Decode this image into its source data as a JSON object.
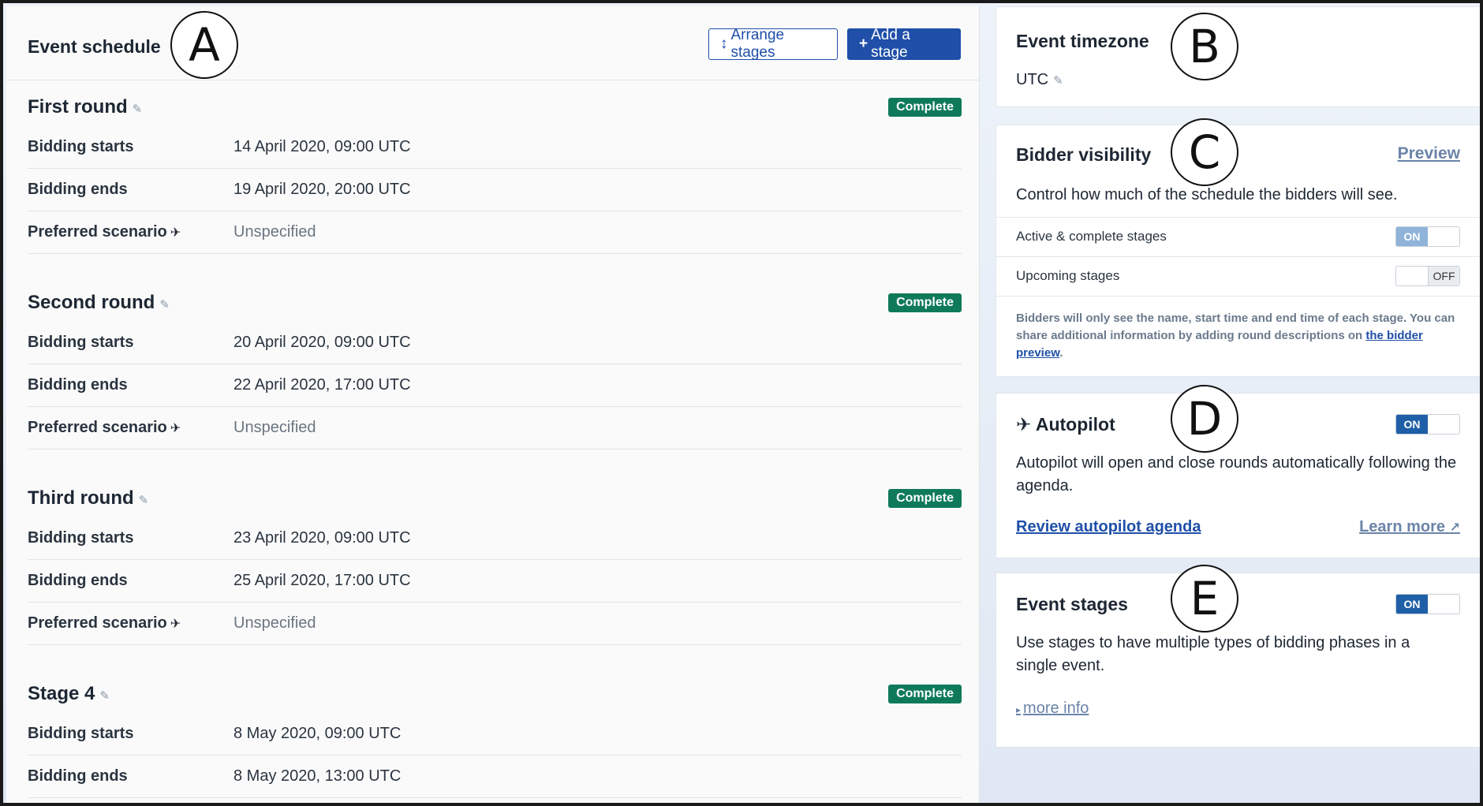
{
  "schedule": {
    "title": "Event schedule",
    "arrange_label": "Arrange stages",
    "arrange_glyph": "↕",
    "add_label": "Add a stage",
    "add_glyph": "+",
    "edit_glyph": "✎",
    "plane_glyph": "✈",
    "stages": [
      {
        "name": "First round",
        "status": "Complete",
        "rows": [
          {
            "label": "Bidding starts",
            "value": "14 April 2020, 09:00 UTC"
          },
          {
            "label": "Bidding ends",
            "value": "19 April 2020, 20:00 UTC"
          },
          {
            "label": "Preferred scenario",
            "value": "Unspecified"
          }
        ]
      },
      {
        "name": "Second round",
        "status": "Complete",
        "rows": [
          {
            "label": "Bidding starts",
            "value": "20 April 2020, 09:00 UTC"
          },
          {
            "label": "Bidding ends",
            "value": "22 April 2020, 17:00 UTC"
          },
          {
            "label": "Preferred scenario",
            "value": "Unspecified"
          }
        ]
      },
      {
        "name": "Third round",
        "status": "Complete",
        "rows": [
          {
            "label": "Bidding starts",
            "value": "23 April 2020, 09:00 UTC"
          },
          {
            "label": "Bidding ends",
            "value": "25 April 2020, 17:00 UTC"
          },
          {
            "label": "Preferred scenario",
            "value": "Unspecified"
          }
        ]
      },
      {
        "name": "Stage 4",
        "status": "Complete",
        "rows": [
          {
            "label": "Bidding starts",
            "value": "8 May 2020, 09:00 UTC"
          },
          {
            "label": "Bidding ends",
            "value": "8 May 2020, 13:00 UTC"
          }
        ]
      }
    ]
  },
  "timezone": {
    "title": "Event timezone",
    "value": "UTC"
  },
  "visibility": {
    "title": "Bidder visibility",
    "preview_label": "Preview",
    "description": "Control how much of the schedule the bidders will see.",
    "active_label": "Active & complete stages",
    "active_state": "ON",
    "upcoming_label": "Upcoming stages",
    "upcoming_state": "OFF",
    "note_text": "Bidders will only see the name, start time and end time of each stage. You can share additional information by adding round descriptions on ",
    "note_link": "the bidder preview",
    "note_end": "."
  },
  "autopilot": {
    "title": "Autopilot",
    "state": "ON",
    "description": "Autopilot will open and close rounds automatically following the agenda.",
    "review_label": "Review autopilot agenda",
    "learn_label": "Learn more",
    "learn_glyph": "↗"
  },
  "event_stages": {
    "title": "Event stages",
    "state": "ON",
    "description": "Use stages to have multiple types of bidding phases in a single event.",
    "more_label": "more info",
    "more_glyph": "▸"
  },
  "markers": {
    "a": "A",
    "b": "B",
    "c": "C",
    "d": "D",
    "e": "E"
  }
}
